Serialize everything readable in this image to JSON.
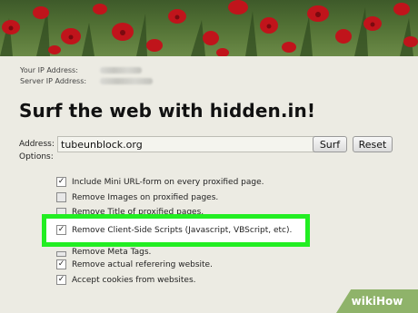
{
  "info": {
    "your_ip_label": "Your IP Address:",
    "server_ip_label": "Server IP Address:"
  },
  "title": "Surf the web with hidden.in!",
  "address": {
    "label": "Address:",
    "value": "tubeunblock.org"
  },
  "buttons": {
    "surf": "Surf",
    "reset": "Reset"
  },
  "options_label": "Options:",
  "options": [
    {
      "label": "Include Mini URL-form on every proxified page.",
      "checked": true
    },
    {
      "label": "Remove Images on proxified pages.",
      "checked": false
    },
    {
      "label": "Remove Title of proxified pages.",
      "checked": false
    },
    {
      "label": "Remove Client-Side Scripts (Javascript, VBScript, etc).",
      "checked": true
    },
    {
      "label": "Remove Meta Tags.",
      "checked": false
    },
    {
      "label": "Remove actual referering website.",
      "checked": true
    },
    {
      "label": "Accept cookies from websites.",
      "checked": true
    }
  ],
  "highlight_color": "#22ee22",
  "watermark": {
    "wiki": "wiki",
    "how": "How"
  }
}
